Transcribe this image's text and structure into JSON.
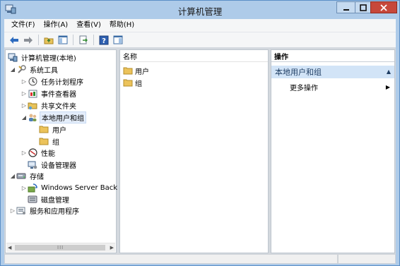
{
  "window": {
    "title": "计算机管理"
  },
  "menu": {
    "items": [
      "文件(F)",
      "操作(A)",
      "查看(V)",
      "帮助(H)"
    ]
  },
  "toolbar": {
    "icons": [
      "back-arrow-icon",
      "forward-arrow-icon",
      "up-folder-icon",
      "show-hide-tree-icon",
      "export-list-icon",
      "help-icon",
      "show-hide-action-pane-icon"
    ]
  },
  "tree": {
    "root": "计算机管理(本地)",
    "system_tools": "系统工具",
    "task_scheduler": "任务计划程序",
    "event_viewer": "事件查看器",
    "shared_folders": "共享文件夹",
    "local_users_groups": "本地用户和组",
    "users": "用户",
    "groups": "组",
    "performance": "性能",
    "device_manager": "设备管理器",
    "storage": "存储",
    "windows_server_backup": "Windows Server Back",
    "disk_management": "磁盘管理",
    "services_apps": "服务和应用程序"
  },
  "list": {
    "column": "名称",
    "rows": [
      "用户",
      "组"
    ]
  },
  "actions": {
    "header": "操作",
    "group": "本地用户和组",
    "more": "更多操作"
  },
  "colors": {
    "frame": "#aecbe9",
    "selection": "#e5eefb",
    "action_group": "#d2e4f7",
    "close_button": "#c7483b"
  }
}
